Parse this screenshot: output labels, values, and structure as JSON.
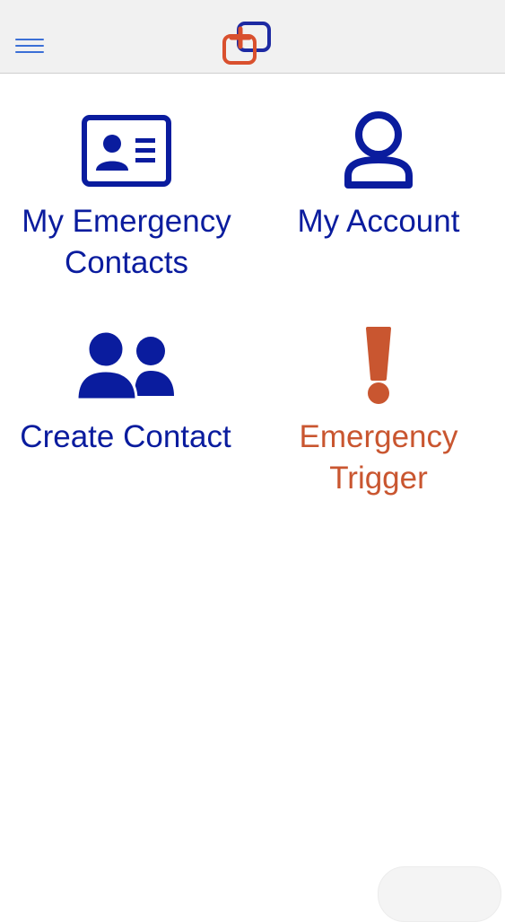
{
  "header": {
    "menu_icon": "hamburger-menu-icon",
    "logo_icon": "app-logo-plus-squares",
    "colors": {
      "logo_red": "#d9502e",
      "logo_blue": "#1d2aa3",
      "menu": "#3b6fd6"
    }
  },
  "tiles": [
    {
      "icon": "contact-card-icon",
      "line1": "My Emergency",
      "line2": "Contacts",
      "color": "#0a1c9e"
    },
    {
      "icon": "user-account-icon",
      "line1": "My Account",
      "line2": "",
      "color": "#0a1c9e"
    },
    {
      "icon": "people-group-icon",
      "line1": "Create Contact",
      "line2": "",
      "color": "#0a1c9e"
    },
    {
      "icon": "exclamation-icon",
      "line1": "Emergency",
      "line2": "Trigger",
      "color": "#c95630"
    }
  ]
}
